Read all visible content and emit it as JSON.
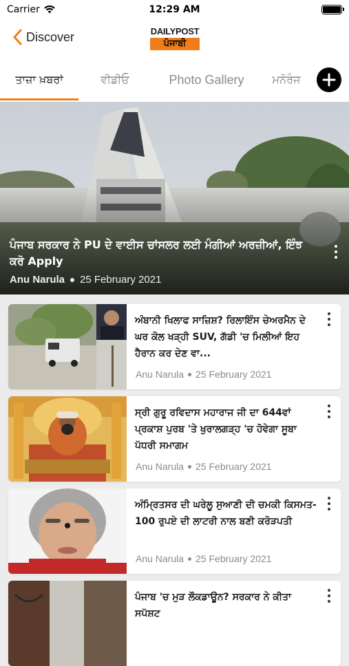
{
  "status_bar": {
    "carrier": "Carrier",
    "time": "12:29 AM"
  },
  "nav": {
    "back_label": "Discover",
    "logo_top": "DAILYPOST",
    "logo_bottom": "ਪੰਜਾਬੀ"
  },
  "tabs": [
    {
      "label": "ਤਾਜ਼ਾ ਖ਼ਬਰਾਂ",
      "active": true
    },
    {
      "label": "ਵੀਡੀਓ",
      "active": false
    },
    {
      "label": "Photo Gallery",
      "active": false
    },
    {
      "label": "ਮਨੋਰੰਜ",
      "active": false
    }
  ],
  "hero": {
    "title": "ਪੰਜਾਬ ਸਰਕਾਰ ਨੇ PU ਦੇ ਵਾਈਸ ਚਾਂਸਲਰ ਲਈ ਮੰਗੀਆਂ ਅਰਜ਼ੀਆਂ, ਇੰਝ ਕਰੋ Apply",
    "author": "Anu Narula",
    "date": "25 February 2021"
  },
  "articles": [
    {
      "title": "ਅੰਬਾਨੀ ਖਿਲਾਫ ਸਾਜ਼ਿਸ਼? ਰਿਲਾਇੰਸ ਚੇਅਰਮੈਨ ਦੇ ਘਰ ਕੋਲ ਖੜ੍ਹੀ SUV, ਗੱਡੀ 'ਚ ਮਿਲੀਆਂ ਇਹ ਹੈਰਾਨ ਕਰ ਦੇਣ ਵਾ...",
      "author": "Anu Narula",
      "date": "25 February 2021"
    },
    {
      "title": "ਸ੍ਰੀ ਗੁਰੂ ਰਵਿਦਾਸ ਮਹਾਰਾਜ ਜੀ ਦਾ 644ਵਾਂ ਪ੍ਰਕਾਸ਼ ਪੁਰਬ 'ਤੇ ਖੁਰਾਲਗੜ੍ਹ 'ਚ ਹੋਵੇਗਾ ਸੂਬਾ ਪੱਧਰੀ ਸਮਾਗਮ",
      "author": "Anu Narula",
      "date": "25 February 2021"
    },
    {
      "title": "ਅੰਮ੍ਰਿਤਸਰ ਦੀ ਘਰੇਲੂ ਸੁਆਣੀ ਦੀ ਚਮਕੀ ਕਿਸਮਤ- 100 ਰੁਪਏ ਦੀ ਲਾਟਰੀ ਨਾਲ ਬਣੀ ਕਰੋੜਪਤੀ",
      "author": "Anu Narula",
      "date": "25 February 2021"
    },
    {
      "title": "ਪੰਜਾਬ 'ਚ ਮੁੜ ਲੌਕਡਾਊਨ? ਸਰਕਾਰ ਨੇ ਕੀਤਾ ਸਪੱਸ਼ਟ",
      "author": "",
      "date": ""
    }
  ],
  "colors": {
    "accent": "#f07d1a",
    "background": "#ececec",
    "text_muted": "#8a8a8a"
  },
  "icons": [
    "wifi-icon",
    "battery-icon",
    "chevron-left-icon",
    "plus-icon",
    "more-vertical-icon"
  ]
}
